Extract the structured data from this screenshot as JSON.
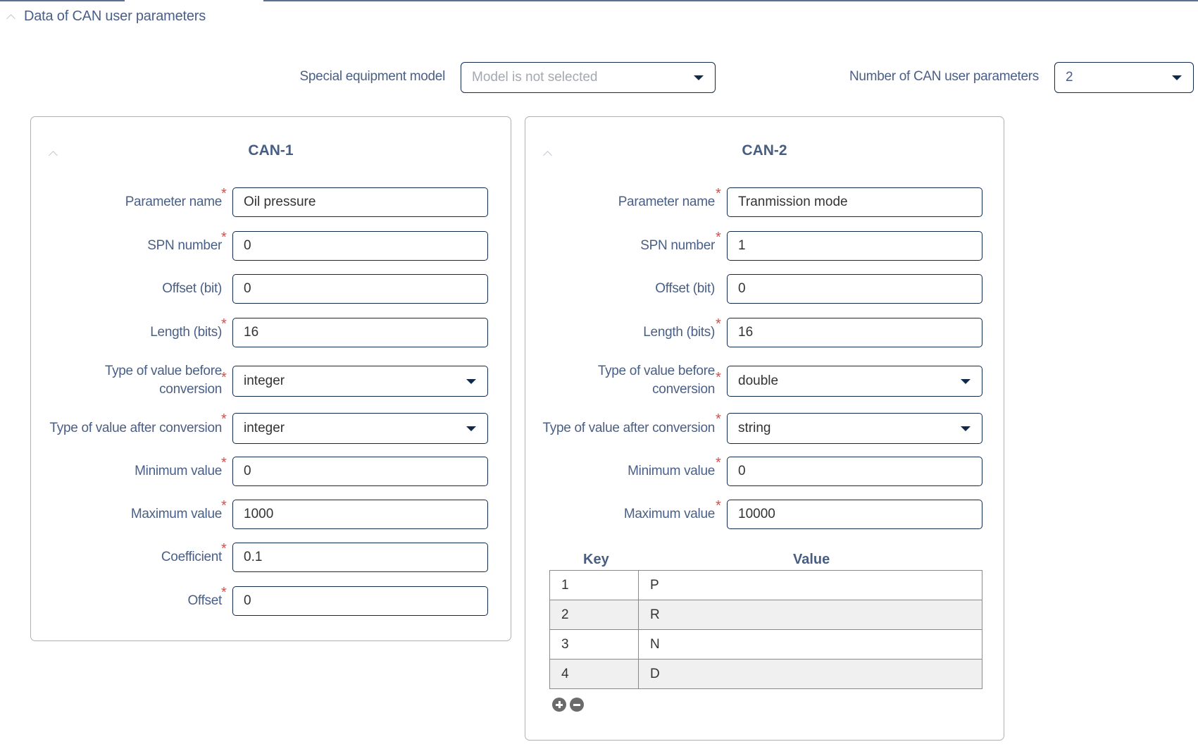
{
  "section": {
    "title": "Data of CAN user parameters",
    "collapse_icon": "chevron-up-icon"
  },
  "top": {
    "equipment_label": "Special equipment model",
    "equipment_placeholder": "Model is not selected",
    "count_label": "Number of CAN user parameters",
    "count_value": "2"
  },
  "can1": {
    "title": "CAN-1",
    "fields": [
      {
        "label": "Parameter name",
        "value": "Oil pressure",
        "required": true,
        "type": "text"
      },
      {
        "label": "SPN number",
        "value": "0",
        "required": true,
        "type": "text"
      },
      {
        "label": "Offset (bit)",
        "value": "0",
        "required": false,
        "type": "text"
      },
      {
        "label": "Length (bits)",
        "value": "16",
        "required": true,
        "type": "text"
      },
      {
        "label": "Type of value before conversion",
        "value": "integer",
        "required": true,
        "type": "select"
      },
      {
        "label": "Type of value after conversion",
        "value": "integer",
        "required": true,
        "type": "select"
      },
      {
        "label": "Minimum value",
        "value": "0",
        "required": true,
        "type": "text"
      },
      {
        "label": "Maximum value",
        "value": "1000",
        "required": true,
        "type": "text"
      },
      {
        "label": "Coefficient",
        "value": "0.1",
        "required": true,
        "type": "text"
      },
      {
        "label": "Offset",
        "value": "0",
        "required": true,
        "type": "text"
      }
    ]
  },
  "can2": {
    "title": "CAN-2",
    "fields": [
      {
        "label": "Parameter name",
        "value": "Tranmission mode",
        "required": true,
        "type": "text"
      },
      {
        "label": "SPN number",
        "value": "1",
        "required": true,
        "type": "text"
      },
      {
        "label": "Offset (bit)",
        "value": "0",
        "required": false,
        "type": "text"
      },
      {
        "label": "Length (bits)",
        "value": "16",
        "required": true,
        "type": "text"
      },
      {
        "label": "Type of value before conversion",
        "value": "double",
        "required": true,
        "type": "select"
      },
      {
        "label": "Type of value after conversion",
        "value": "string",
        "required": true,
        "type": "select"
      },
      {
        "label": "Minimum value",
        "value": "0",
        "required": true,
        "type": "text"
      },
      {
        "label": "Maximum value",
        "value": "10000",
        "required": true,
        "type": "text"
      }
    ],
    "table": {
      "key_header": "Key",
      "value_header": "Value",
      "rows": [
        {
          "key": "1",
          "value": "P"
        },
        {
          "key": "2",
          "value": "R"
        },
        {
          "key": "3",
          "value": "N"
        },
        {
          "key": "4",
          "value": "D"
        }
      ],
      "add_icon": "plus-circle-icon",
      "remove_icon": "minus-circle-icon"
    }
  },
  "required_mark": "*",
  "colors": {
    "label": "#4a5f85",
    "title": "#485d82",
    "border": "#10294b",
    "required": "#d2504b"
  }
}
